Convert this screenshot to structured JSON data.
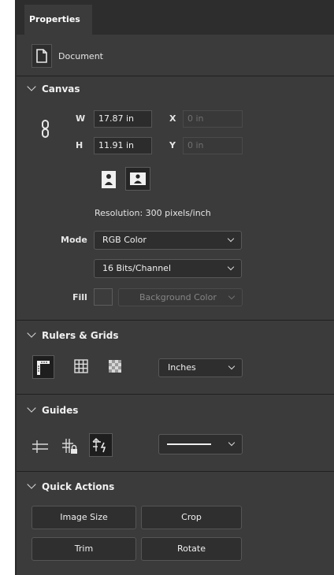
{
  "tab": {
    "label": "Properties"
  },
  "document": {
    "label": "Document",
    "icon": "document-icon"
  },
  "canvas": {
    "header": "Canvas",
    "w_label": "W",
    "w_value": "17.87 in",
    "h_label": "H",
    "h_value": "11.91 in",
    "x_label": "X",
    "x_value": "0 in",
    "y_label": "Y",
    "y_value": "0 in",
    "resolution": "Resolution: 300 pixels/inch",
    "mode_label": "Mode",
    "mode_value": "RGB Color",
    "depth_value": "16 Bits/Channel",
    "fill_label": "Fill",
    "fill_value": "Background Color"
  },
  "rulers": {
    "header": "Rulers & Grids",
    "units_value": "Inches"
  },
  "guides": {
    "header": "Guides"
  },
  "quick_actions": {
    "header": "Quick Actions",
    "image_size": "Image Size",
    "crop": "Crop",
    "trim": "Trim",
    "rotate": "Rotate"
  },
  "colors": {
    "panel": "#3b3b3b",
    "field": "#2c2c2c",
    "tabbar": "#2d2d2d"
  }
}
